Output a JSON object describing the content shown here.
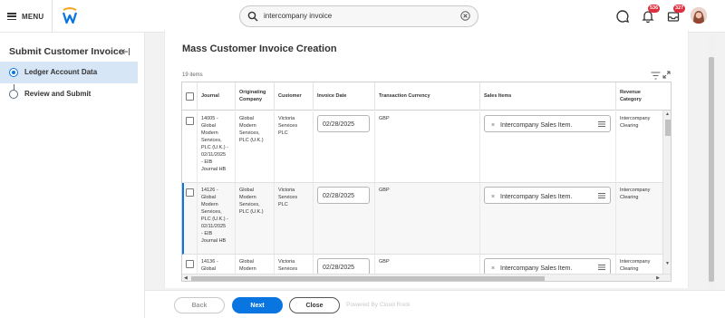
{
  "header": {
    "menu_label": "MENU",
    "search_value": "intercompany invoice",
    "notifications_badge": "536",
    "inbox_badge": "327",
    "accent_color": "#0875e1",
    "badge_color": "#de2d3c",
    "icons": [
      "hamburger-icon",
      "workday-logo",
      "search-icon",
      "clear-icon",
      "chat-icon",
      "bell-icon",
      "inbox-icon",
      "avatar"
    ]
  },
  "sidebar": {
    "title": "Submit Customer Invoice",
    "steps": [
      {
        "label": "Ledger Account Data",
        "active": true
      },
      {
        "label": "Review and Submit",
        "active": false
      }
    ]
  },
  "main": {
    "title": "Mass Customer Invoice Creation",
    "item_count": "19 items",
    "columns": [
      {
        "label": "Journal"
      },
      {
        "label_lines": [
          "Originating",
          "Company"
        ]
      },
      {
        "label": "Customer"
      },
      {
        "label": "Invoice Date"
      },
      {
        "label": "Transaction Currency"
      },
      {
        "label": "Sales Items"
      },
      {
        "label_lines": [
          "Revenue",
          "Category"
        ]
      }
    ],
    "rows": [
      {
        "journal_lines": [
          "14005 -",
          "Global",
          "Modern",
          "Services,",
          "PLC (U.K.) -",
          "02/11/2025",
          "- EIB",
          "Journal HB"
        ],
        "company_lines": [
          "Global",
          "Modern",
          "Services,",
          "PLC (U.K.)"
        ],
        "customer_lines": [
          "Victoria",
          "Services",
          "PLC"
        ],
        "invoice_date": "02/28/2025",
        "currency": "GBP",
        "sales_item": "Intercompany Sales Item.",
        "revenue_lines": [
          "Intercompany",
          "Clearing"
        ],
        "selected": false
      },
      {
        "journal_lines": [
          "14126 -",
          "Global",
          "Modern",
          "Services,",
          "PLC (U.K.) -",
          "02/11/2025",
          "- EIB",
          "Journal HB"
        ],
        "company_lines": [
          "Global",
          "Modern",
          "Services,",
          "PLC (U.K.)"
        ],
        "customer_lines": [
          "Victoria",
          "Services",
          "PLC"
        ],
        "invoice_date": "02/28/2025",
        "currency": "GBP",
        "sales_item": "Intercompany Sales Item.",
        "revenue_lines": [
          "Intercompany",
          "Clearing"
        ],
        "selected": true
      },
      {
        "journal_lines": [
          "14136 -",
          "Global"
        ],
        "company_lines": [
          "Global",
          "Modern"
        ],
        "customer_lines": [
          "Victoria",
          "Services"
        ],
        "invoice_date": "02/28/2025",
        "currency": "GBP",
        "sales_item": "Intercompany Sales Item.",
        "revenue_lines": [
          "Intercompany",
          "Clearing"
        ],
        "selected": false
      }
    ]
  },
  "footer": {
    "back_label": "Back",
    "next_label": "Next",
    "close_label": "Close",
    "powered_by": "Powered By Cloud Rock"
  }
}
